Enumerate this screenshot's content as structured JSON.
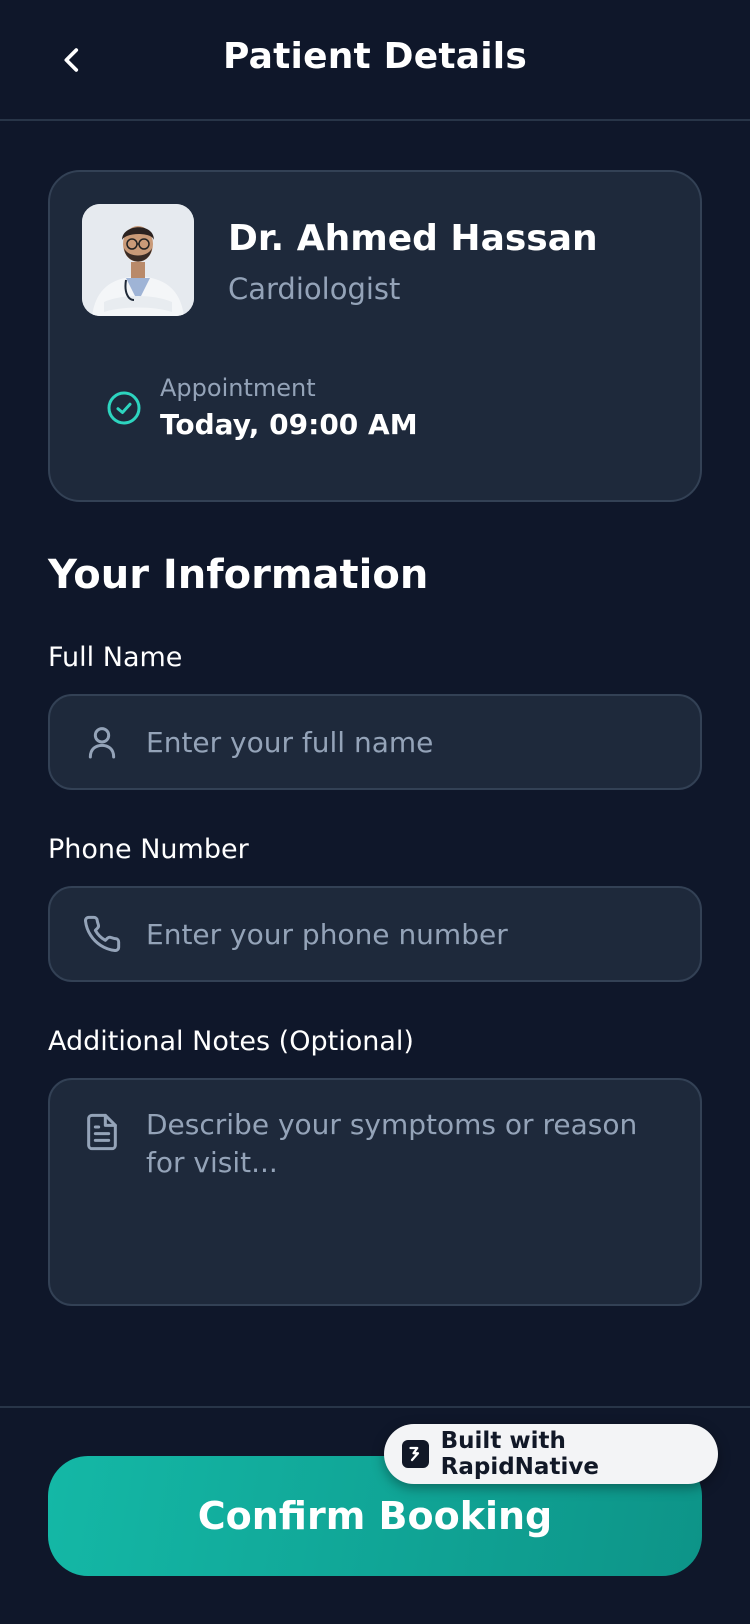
{
  "header": {
    "title": "Patient Details",
    "back_icon": "chevron-left-icon"
  },
  "doctor": {
    "name": "Dr. Ahmed Hassan",
    "specialty": "Cardiologist",
    "appointment_label": "Appointment",
    "appointment_value": "Today, 09:00 AM",
    "appointment_icon": "check-circle-icon"
  },
  "form": {
    "section_title": "Your Information",
    "full_name": {
      "label": "Full Name",
      "placeholder": "Enter your full name",
      "value": "",
      "icon": "user-icon"
    },
    "phone": {
      "label": "Phone Number",
      "placeholder": "Enter your phone number",
      "value": "",
      "icon": "phone-icon"
    },
    "notes": {
      "label": "Additional Notes (Optional)",
      "placeholder": "Describe your symptoms or reason for visit...",
      "value": "",
      "icon": "document-icon"
    }
  },
  "footer": {
    "confirm_label": "Confirm Booking",
    "badge_label": "Built with RapidNative"
  },
  "colors": {
    "background": "#0f172a",
    "card": "#1e293b",
    "border": "#334155",
    "muted_text": "#94a3b8",
    "accent": "#14b8a6",
    "accent_dark": "#0d9488"
  }
}
